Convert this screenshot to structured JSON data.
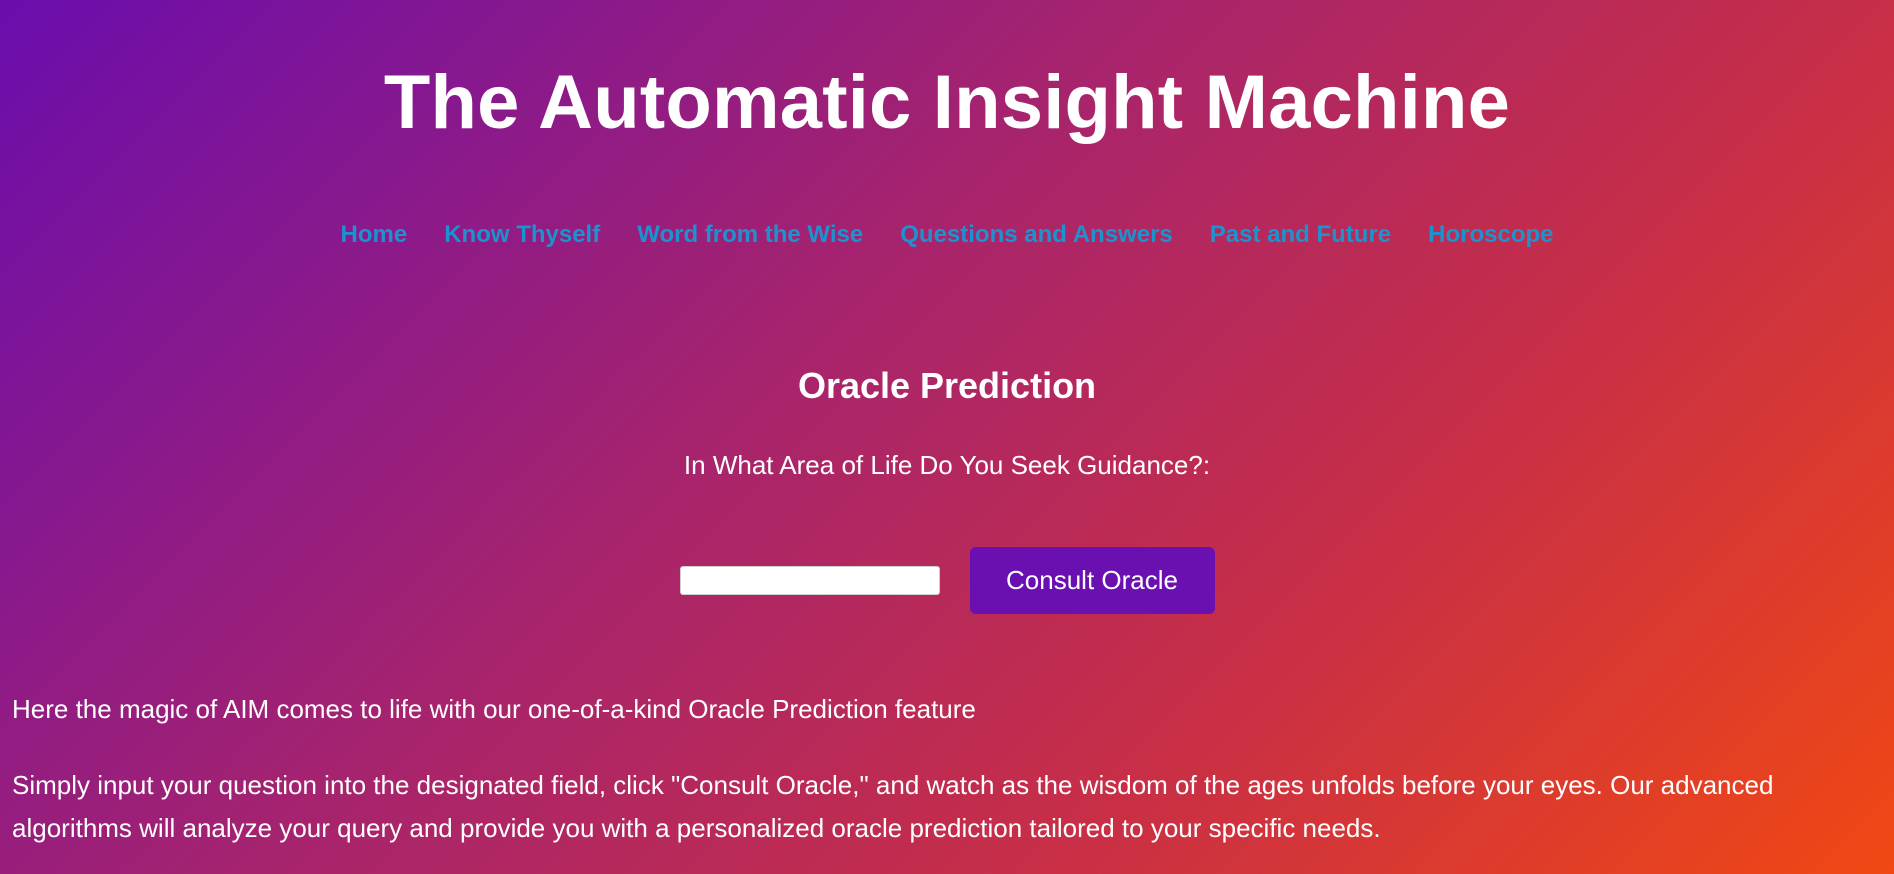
{
  "header": {
    "title": "The Automatic Insight Machine"
  },
  "nav": {
    "items": [
      {
        "label": "Home"
      },
      {
        "label": "Know Thyself"
      },
      {
        "label": "Word from the Wise"
      },
      {
        "label": "Questions and Answers"
      },
      {
        "label": "Past and Future"
      },
      {
        "label": "Horoscope"
      }
    ],
    "link_color": "#1c93cf"
  },
  "oracle": {
    "title": "Oracle Prediction",
    "prompt_label": "In What Area of Life Do You Seek Guidance?:",
    "input_value": "",
    "button_label": "Consult Oracle",
    "button_color": "#6a10b0"
  },
  "content": {
    "intro": "Here the magic of AIM comes to life with our one-of-a-kind Oracle Prediction feature",
    "instructions": "Simply input your question into the designated field, click \"Consult Oracle,\" and watch as the wisdom of the ages unfolds before your eyes. Our advanced algorithms will analyze your query and provide you with a personalized oracle prediction tailored to your specific needs."
  },
  "theme": {
    "gradient_start": "#6a0dad",
    "gradient_end": "#f14813",
    "text_color": "#ffffff"
  }
}
